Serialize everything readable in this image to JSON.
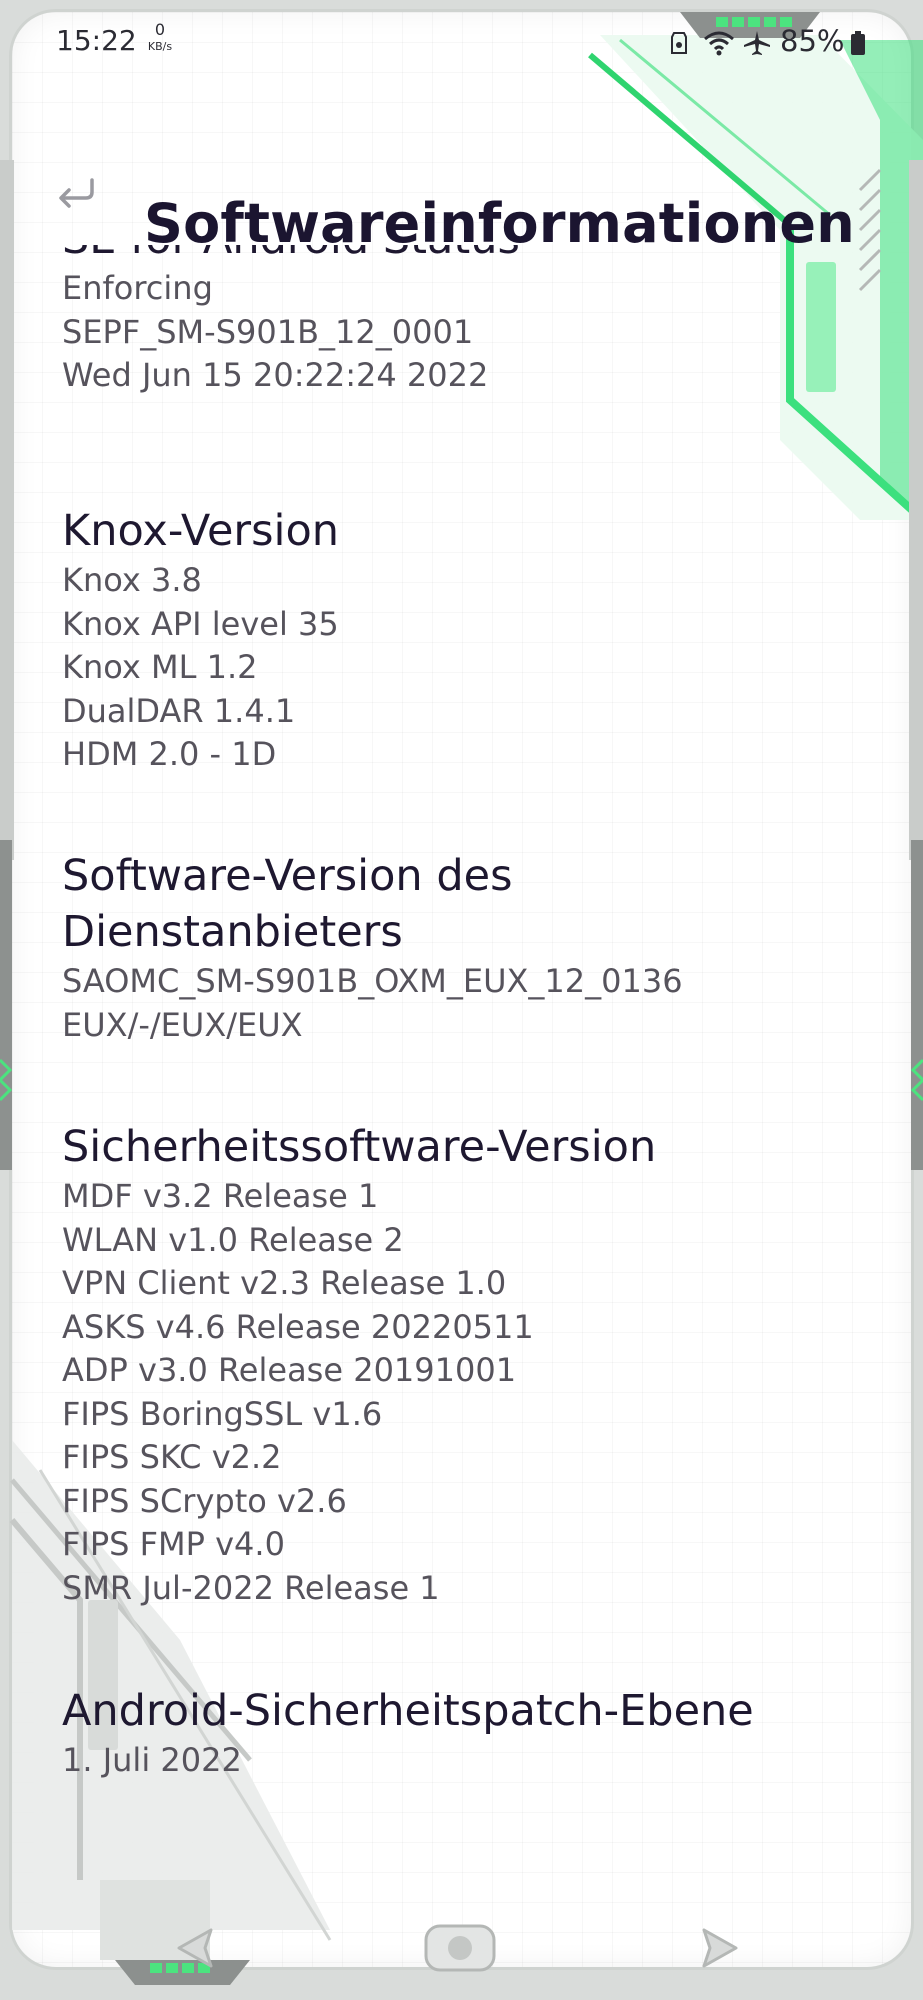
{
  "status_bar": {
    "time": "15:22",
    "net_speed_value": "0",
    "net_speed_unit": "KB/s",
    "battery": "85%",
    "icons": [
      "data-saver-icon",
      "wifi-icon",
      "airplane-icon",
      "battery-icon"
    ]
  },
  "header": {
    "title": "Softwareinformationen",
    "back_icon": "back-arrow-icon"
  },
  "sections": [
    {
      "title": "SE for Android Status",
      "lines": [
        "Enforcing",
        "SEPF_SM-S901B_12_0001",
        "Wed Jun 15 20:22:24 2022"
      ]
    },
    {
      "title": "Knox-Version",
      "lines": [
        "Knox 3.8",
        "Knox API level 35",
        "Knox ML 1.2",
        "DualDAR 1.4.1",
        "HDM 2.0 - 1D"
      ]
    },
    {
      "title_lines": [
        "Software-Version des",
        "Dienstanbieters"
      ],
      "lines": [
        "SAOMC_SM-S901B_OXM_EUX_12_0136",
        "EUX/-/EUX/EUX"
      ]
    },
    {
      "title": "Sicherheitssoftware-Version",
      "lines": [
        "MDF v3.2 Release 1",
        "WLAN v1.0 Release 2",
        "VPN Client v2.3 Release 1.0",
        "ASKS v4.6 Release 20220511",
        "ADP v3.0 Release 20191001",
        "FIPS BoringSSL v1.6",
        "FIPS SKC v2.2",
        "FIPS SCrypto v2.6",
        "FIPS FMP v4.0",
        "SMR Jul-2022 Release 1"
      ]
    },
    {
      "title": "Android-Sicherheitspatch-Ebene",
      "lines": [
        "1. Juli 2022"
      ]
    }
  ],
  "nav_bar": {
    "icons": [
      "nav-back-icon",
      "nav-home-icon",
      "nav-recents-icon"
    ]
  },
  "theme": {
    "accent": "#34e07a",
    "title_color": "#1e1830",
    "text_color": "#56535c",
    "background": "#ffffff"
  }
}
